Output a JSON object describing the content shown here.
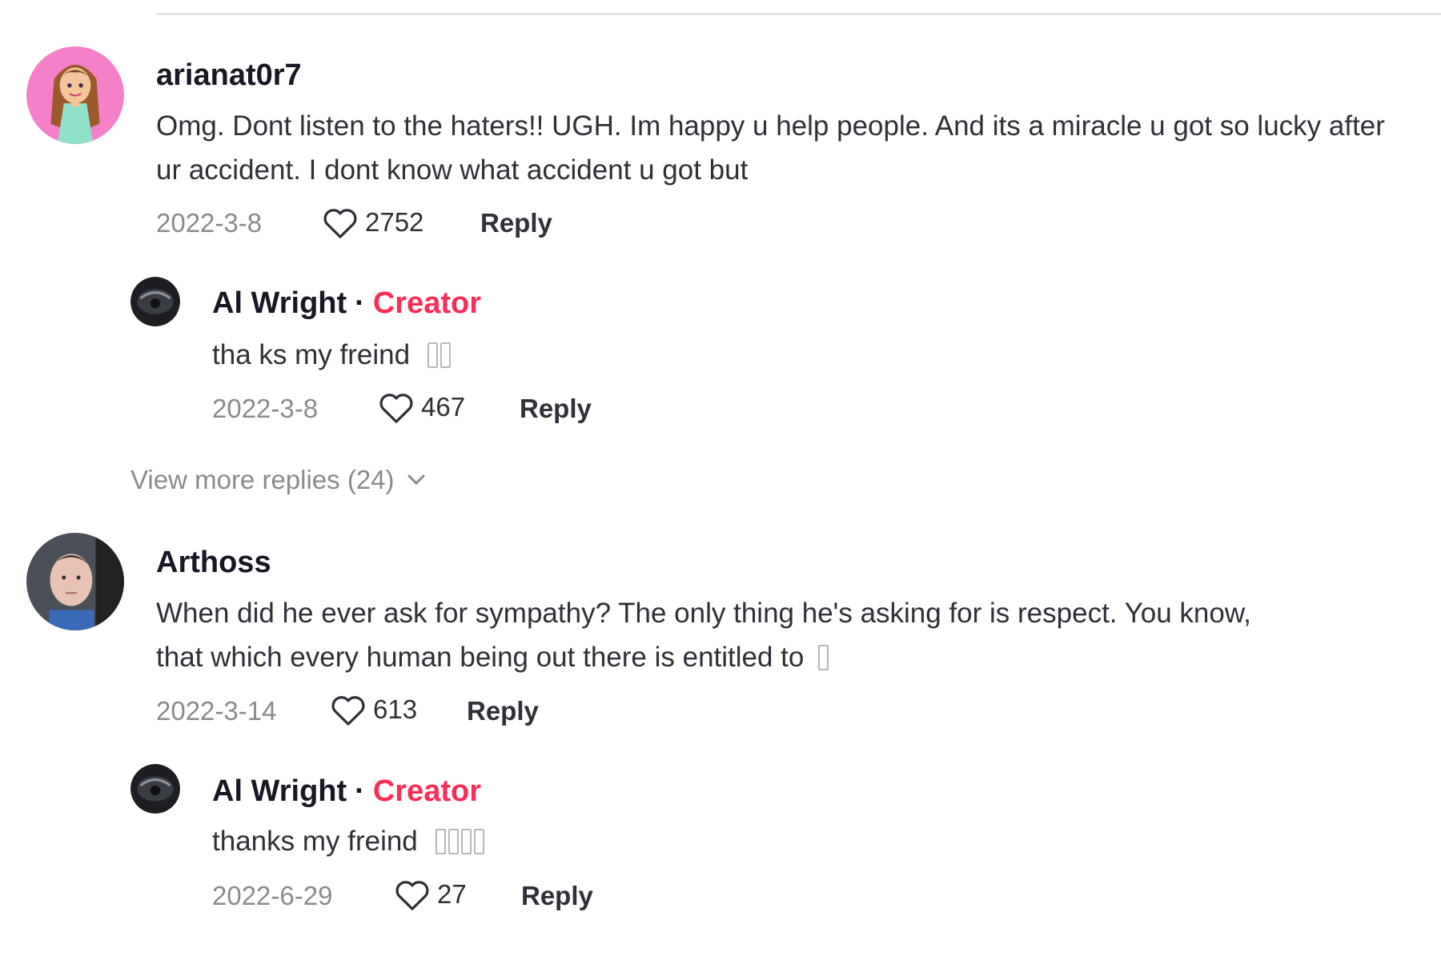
{
  "comments": [
    {
      "username": "arianat0r7",
      "text": "Omg. Dont listen to the haters!! UGH. Im happy u help people. And its a miracle u got so lucky after ur accident. I dont know what accident u got but",
      "date": "2022-3-8",
      "likes": "2752",
      "reply_label": "Reply",
      "avatar_icon": "cartoon-girl-avatar",
      "avatar_bg": "#f57fc8",
      "reply": {
        "username": "Al Wright",
        "separator": "·",
        "badge": "Creator",
        "text": "tha ks my freind",
        "date": "2022-3-8",
        "likes": "467",
        "reply_label": "Reply",
        "avatar_icon": "dark-round-avatar"
      },
      "view_more": "View more replies (24)"
    },
    {
      "username": "Arthoss",
      "text_line1": "When did he ever ask for sympathy? The only thing he's asking for is respect. You know,",
      "text_line2": "that which every human being out there is entitled to",
      "date": "2022-3-14",
      "likes": "613",
      "reply_label": "Reply",
      "avatar_icon": "person-photo-avatar",
      "reply": {
        "username": "Al Wright",
        "separator": "·",
        "badge": "Creator",
        "text": "thanks my freind",
        "date": "2022-6-29",
        "likes": "27",
        "reply_label": "Reply",
        "avatar_icon": "dark-round-avatar"
      }
    }
  ],
  "colors": {
    "creator": "#fe2c55",
    "muted": "#8a8b91",
    "text": "#161823"
  },
  "icons": {
    "like": "heart-outline-icon",
    "expand": "chevron-down-icon",
    "emoji": "missing-glyph-box"
  }
}
